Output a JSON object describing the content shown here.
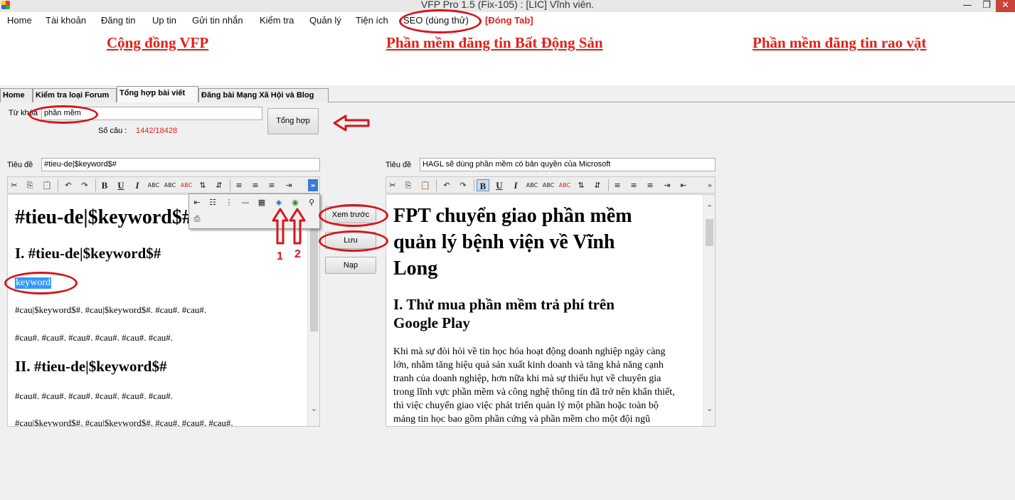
{
  "window": {
    "title": "VFP Pro 1.5 (Fix-105) : [LIC] Vĩnh viễn.",
    "minimize": "—",
    "maximize": "❐"
  },
  "menu": {
    "items": [
      "Home",
      "Tài khoản",
      "Đăng tin",
      "Up tin",
      "Gửi tin nhắn",
      "Kiểm tra",
      "Quản lý",
      "Tiện ích",
      "SEO (dùng thử)"
    ],
    "close_tab": "[Đóng Tab]"
  },
  "banner": {
    "links": [
      "Cộng đồng VFP",
      "Phần mềm đăng tin Bất Động Sản",
      "Phần mềm đăng tin rao vặt"
    ]
  },
  "tabs": [
    "Home",
    "Kiểm tra loại Forum",
    "Tổng hợp bài viết",
    "Đăng bài Mạng Xã Hội và Blog"
  ],
  "form": {
    "keyword_label": "Từ khóa",
    "keyword_value": "phần mềm",
    "count_label": "Số câu :",
    "count_value": "1442/18428",
    "aggregate_button": "Tổng hợp"
  },
  "left_editor": {
    "title_label": "Tiêu đề",
    "title_value": "#tieu-de|$keyword$#",
    "h1": "#tieu-de|$keyword$#",
    "h2a": "I. #tieu-de|$keyword$#",
    "selected_word": "keyword",
    "p1": "#cau|$keyword$#. #cau|$keyword$#. #cau#. #cau#.",
    "p2": "#cau#. #cau#. #cau#. #cau#. #cau#. #cau#.",
    "h2b": "II. #tieu-de|$keyword$#",
    "p3": "#cau#. #cau#. #cau#. #cau#. #cau#. #cau#.",
    "p4": "#cau|$keyword$#. #cau|$keyword$#. #cau#. #cau#. #cau#."
  },
  "middle_buttons": {
    "preview": "Xem trước",
    "save": "Lưu",
    "load": "Nạp"
  },
  "annotations": {
    "num1": "1",
    "num2": "2"
  },
  "right_editor": {
    "title_label": "Tiêu đề",
    "title_value": "HAGL sẽ dùng phần mềm có bản quyền của Microsoft",
    "h1_l1": "FPT chuyển giao phần mềm",
    "h1_l2": "quản lý bệnh viện về Vĩnh",
    "h1_l3": "Long",
    "h2_l1": "I. Thử mua phần mềm trả phí trên",
    "h2_l2": "Google Play",
    "p_lines": [
      "Khi mà sự đòi hỏi về tin học hóa hoạt động doanh nghiệp ngày càng",
      "lớn, nhằm tăng hiệu quả sản xuất kinh doanh và tăng khả năng cạnh",
      "tranh của doanh nghiệp, hơn nữa khi mà sự thiếu hụt về chuyên gia",
      "trong lĩnh vực phần mềm và công nghệ thông tin đã trở nên khẩn thiết,",
      "thì việc chuyển giao việc phát triển quản lý một phần hoặc toàn bộ",
      "mảng tin học bao gồm phần cứng và phần mềm cho một đội ngũ"
    ]
  },
  "icons": {
    "cut": "✂",
    "copy": "⎘",
    "paste": "📋",
    "undo": "↶",
    "redo": "↷",
    "bold": "B",
    "italic": "I",
    "underline": "U",
    "align_left": "≡",
    "align_center": "≡",
    "align_right": "≡",
    "indent": "⇥",
    "more": "»"
  },
  "colors": {
    "accent_red": "#d8141b",
    "link_red": "#e0211a",
    "count_red": "#e0211a"
  }
}
